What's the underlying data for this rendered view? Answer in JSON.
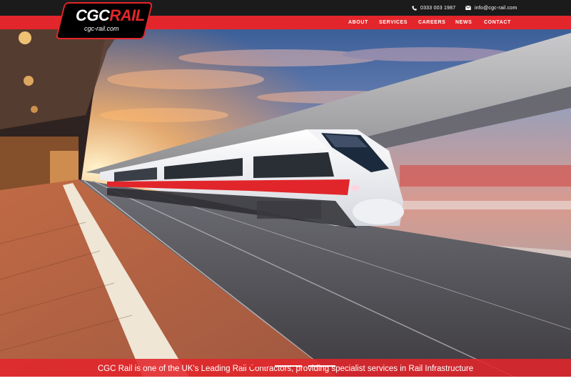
{
  "header": {
    "phone": "0333 003 1987",
    "email": "info@cgc-rail.com",
    "phone_icon": "phone-icon",
    "email_icon": "envelope-icon"
  },
  "logo": {
    "brand_part1": "CGC",
    "brand_part2": "RAIL",
    "url": "cgc-rail.com"
  },
  "nav": {
    "items": [
      "ABOUT",
      "SERVICES",
      "CAREERS",
      "NEWS",
      "CONTACT"
    ]
  },
  "hero": {
    "caption": "CGC Rail is one of the UK's Leading Rail Contractors, providing specialist services in Rail Infrastructure",
    "slides": 3,
    "active_slide": 1
  },
  "colors": {
    "brand_red": "#e3262b",
    "topbar": "#1b1b1b",
    "logo_black": "#000000"
  }
}
